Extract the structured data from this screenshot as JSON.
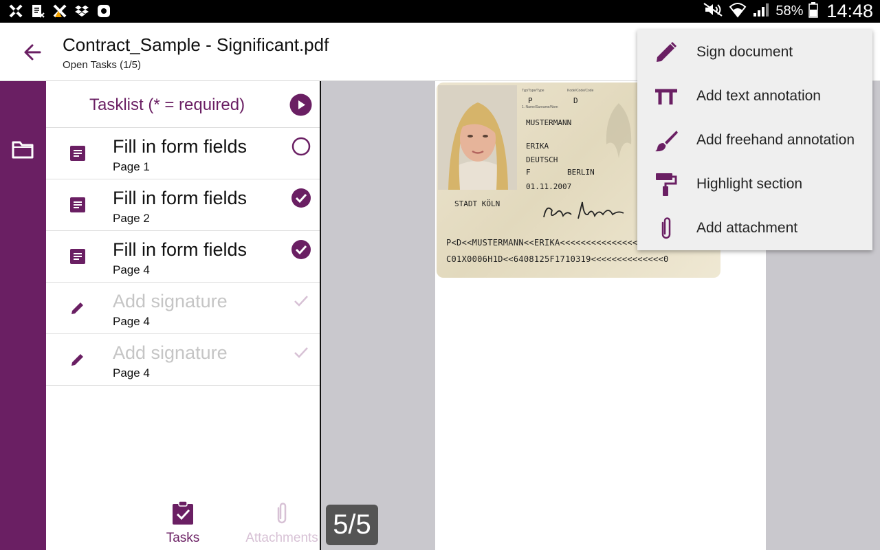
{
  "colors": {
    "brand": "#6a1f63",
    "rail": "#6a1f63",
    "muted": "#c5c5c5",
    "viewer_bg": "#c9c8cd",
    "menu_bg": "#efefef"
  },
  "status_bar": {
    "icons_left": [
      "app-x-icon",
      "document-icon",
      "app-x-warning-icon",
      "dropbox-icon",
      "galaxy-app-icon"
    ],
    "icons_right": [
      "mute-icon",
      "wifi-icon",
      "signal-icon",
      "battery-icon"
    ],
    "battery": "58%",
    "time": "14:48"
  },
  "header": {
    "title": "Contract_Sample - Significant.pdf",
    "subtitle": "Open Tasks (1/5)"
  },
  "tasklist": {
    "title": "Tasklist (* = required)",
    "tasks": [
      {
        "title": "Fill in form fields",
        "page": "Page 1",
        "icon": "form-icon",
        "status": "open"
      },
      {
        "title": "Fill in form fields",
        "page": "Page 2",
        "icon": "form-icon",
        "status": "done"
      },
      {
        "title": "Fill in form fields",
        "page": "Page 4",
        "icon": "form-icon",
        "status": "done"
      },
      {
        "title": "Add signature",
        "page": "Page 4",
        "icon": "pencil-icon",
        "status": "disabled"
      },
      {
        "title": "Add signature",
        "page": "Page 4",
        "icon": "pencil-icon",
        "status": "disabled"
      }
    ]
  },
  "bottom_tabs": {
    "tasks": "Tasks",
    "attachments": "Attachments"
  },
  "page_counter": "5/5",
  "id_card": {
    "surname": "MUSTERMANN",
    "given_name": "ERIKA",
    "nationality": "DEUTSCH",
    "birth_code": "F",
    "birth_place": "BERLIN",
    "date": "01.11.2007",
    "authority": "STADT KÖLN",
    "type_p": "P",
    "type_d": "D",
    "caption_type": "Typ/Type/Type",
    "caption_code": "Kode/Code/Code",
    "caption_name": "1. Name/Surname/Nom",
    "signature": "Erika Mustermann",
    "mrz1": "P<D<<MUSTERMANN<<ERIKA<<<<<<<<<<<<<<<<<<<",
    "mrz2": "C01X0006H1D<<6408125F1710319<<<<<<<<<<<<<<0"
  },
  "menu": {
    "items": [
      {
        "label": "Sign document",
        "icon": "pencil-icon"
      },
      {
        "label": "Add text annotation",
        "icon": "text-size-icon"
      },
      {
        "label": "Add freehand annotation",
        "icon": "brush-icon"
      },
      {
        "label": "Highlight section",
        "icon": "paint-roller-icon"
      },
      {
        "label": "Add attachment",
        "icon": "paperclip-icon"
      }
    ]
  }
}
